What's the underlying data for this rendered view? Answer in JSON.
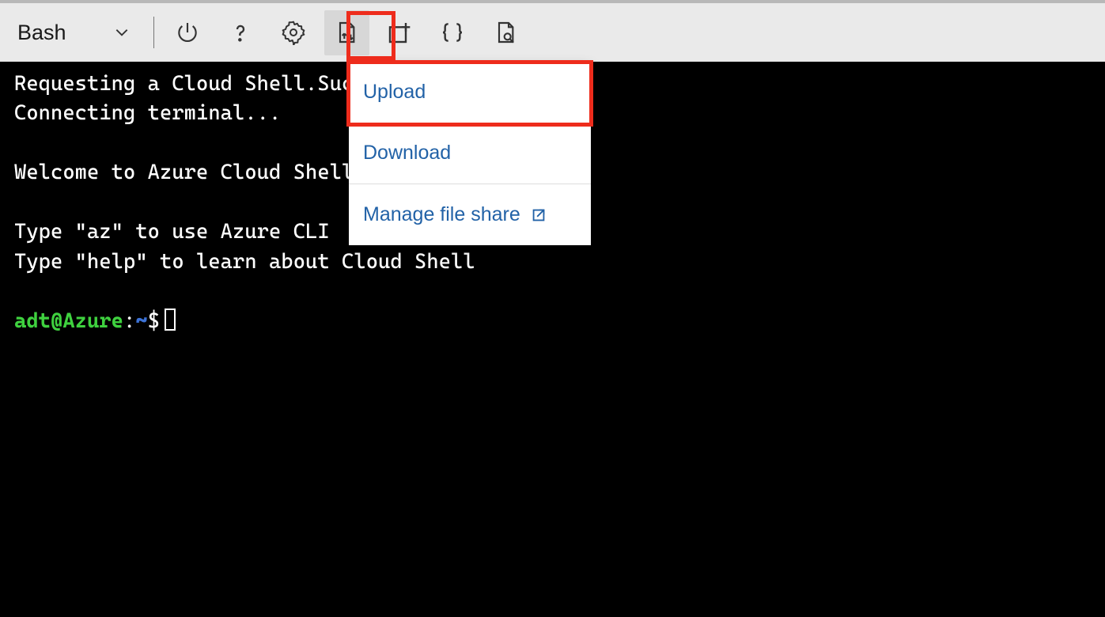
{
  "toolbar": {
    "shell_label": "Bash",
    "icons": [
      "power",
      "help",
      "settings",
      "file-updown",
      "new-session",
      "braces",
      "preview"
    ]
  },
  "menu": {
    "items": [
      {
        "label": "Upload"
      },
      {
        "label": "Download"
      },
      {
        "label": "Manage file share",
        "external": true
      }
    ]
  },
  "terminal": {
    "lines": [
      "Requesting a Cloud Shell.Succeeded.",
      "Connecting terminal...",
      "",
      "Welcome to Azure Cloud Shell",
      "",
      "Type \"az\" to use Azure CLI",
      "Type \"help\" to learn about Cloud Shell",
      ""
    ],
    "prompt_user": "adt@Azure",
    "prompt_colon": ":",
    "prompt_path": "~",
    "prompt_symbol": "$"
  }
}
